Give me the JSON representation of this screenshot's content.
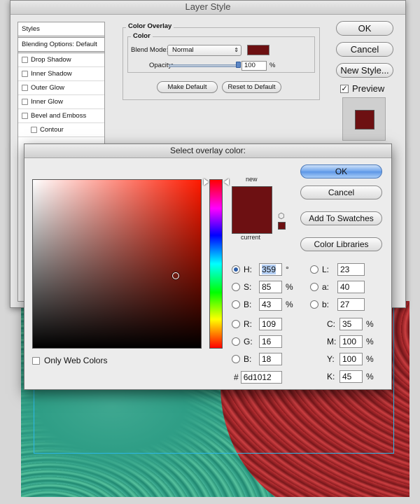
{
  "layer_style": {
    "title": "Layer Style",
    "styles_list": [
      {
        "label": "Styles",
        "type": "header"
      },
      {
        "label": "Blending Options: Default",
        "type": "header"
      },
      {
        "label": "Drop Shadow",
        "type": "check"
      },
      {
        "label": "Inner Shadow",
        "type": "check"
      },
      {
        "label": "Outer Glow",
        "type": "check"
      },
      {
        "label": "Inner Glow",
        "type": "check"
      },
      {
        "label": "Bevel and Emboss",
        "type": "check"
      },
      {
        "label": "Contour",
        "type": "sub"
      }
    ],
    "overlay_group_title": "Color Overlay",
    "color_group_title": "Color",
    "blend_mode_label": "Blend Mode:",
    "blend_mode_value": "Normal",
    "opacity_label": "Opacity:",
    "opacity_value": "100",
    "opacity_fraction": 1.0,
    "opacity_unit": "%",
    "make_default": "Make Default",
    "reset_default": "Reset to Default",
    "ok": "OK",
    "cancel": "Cancel",
    "new_style": "New Style...",
    "preview_label": "Preview",
    "preview_checked": true
  },
  "picker": {
    "title": "Select overlay color:",
    "new_label": "new",
    "current_label": "current",
    "new_color": "#6d1012",
    "current_color": "#6d1012",
    "ok": "OK",
    "cancel": "Cancel",
    "add_swatches": "Add To Swatches",
    "color_libraries": "Color Libraries",
    "only_web_colors": "Only Web Colors",
    "hsb": [
      {
        "label": "H:",
        "value": "359",
        "unit": "°",
        "selected": true
      },
      {
        "label": "S:",
        "value": "85",
        "unit": "%",
        "selected": false
      },
      {
        "label": "B:",
        "value": "43",
        "unit": "%",
        "selected": false
      }
    ],
    "rgb": [
      {
        "label": "R:",
        "value": "109"
      },
      {
        "label": "G:",
        "value": "16"
      },
      {
        "label": "B:",
        "value": "18"
      }
    ],
    "lab": [
      {
        "label": "L:",
        "value": "23"
      },
      {
        "label": "a:",
        "value": "40"
      },
      {
        "label": "b:",
        "value": "27"
      }
    ],
    "cmyk": [
      {
        "label": "C:",
        "value": "35",
        "unit": "%"
      },
      {
        "label": "M:",
        "value": "100",
        "unit": "%"
      },
      {
        "label": "Y:",
        "value": "100",
        "unit": "%"
      },
      {
        "label": "K:",
        "value": "45",
        "unit": "%"
      }
    ],
    "hex_label": "#",
    "hex_value": "6d1012",
    "field_hue_color": "#ff1a00"
  }
}
